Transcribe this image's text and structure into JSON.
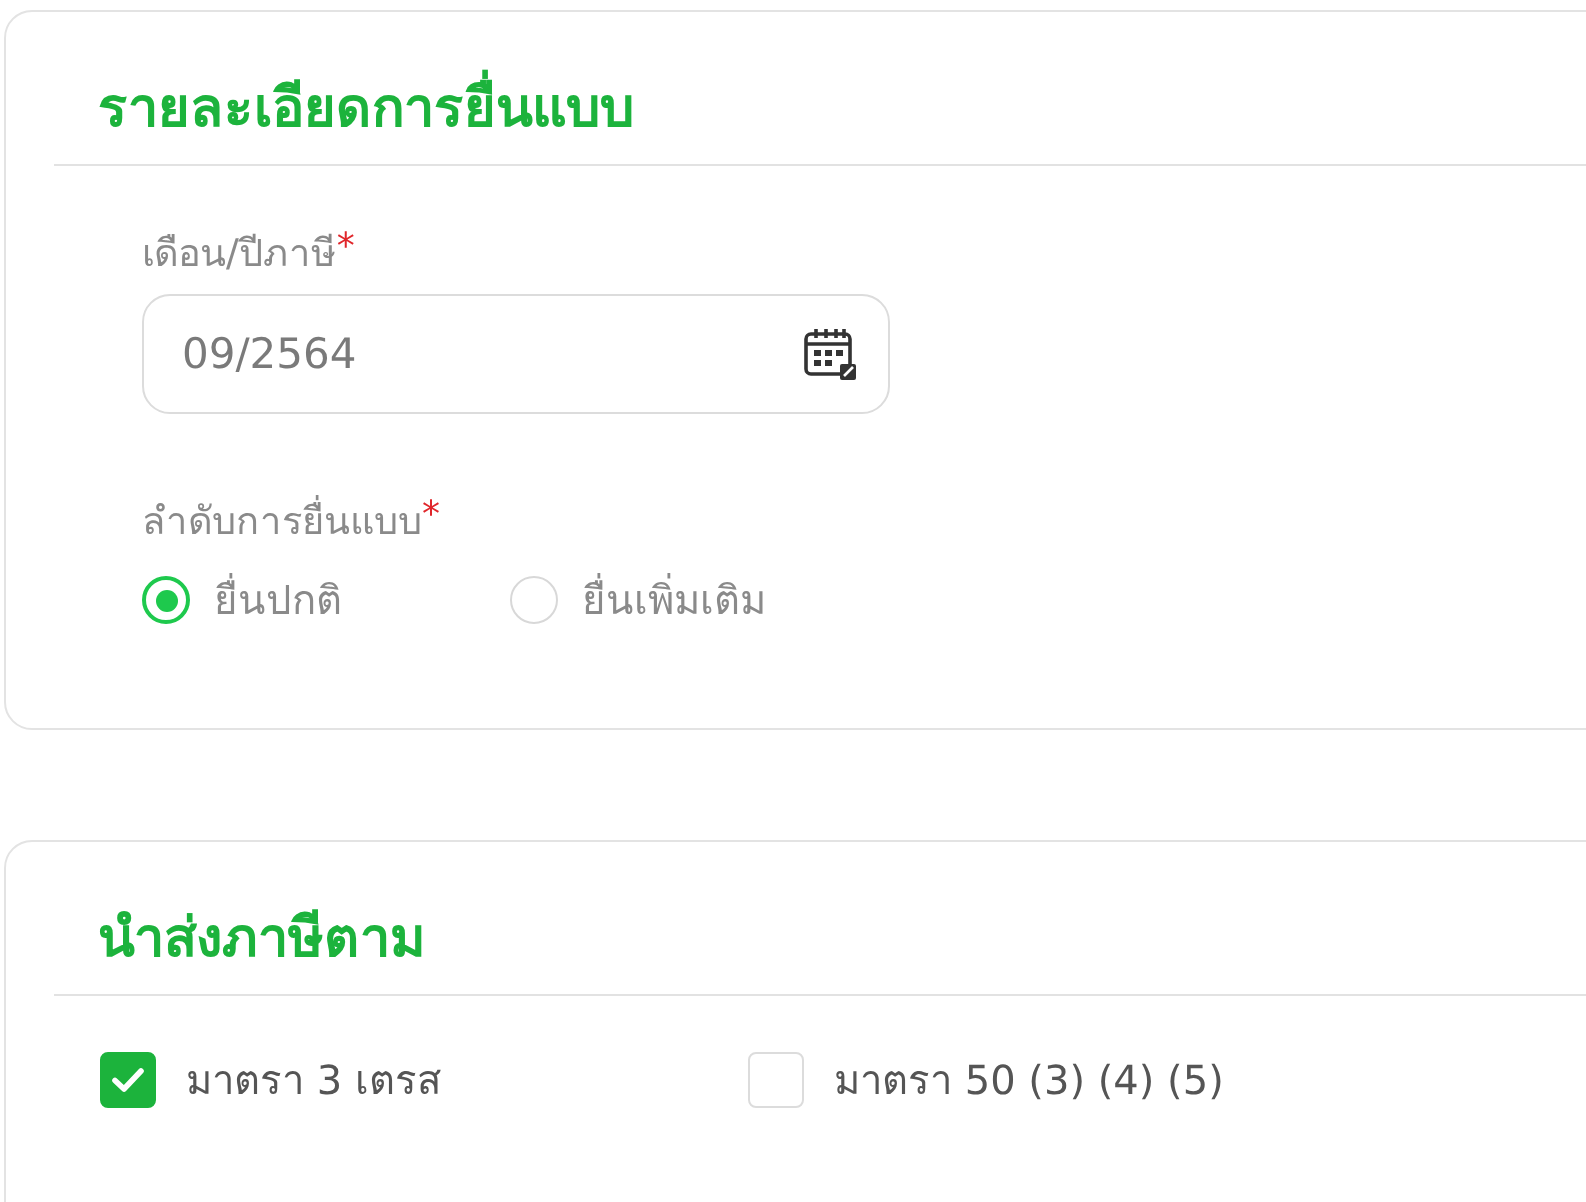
{
  "sections": [
    {
      "title": "รายละเอียดการยื่นแบบ",
      "fields": [
        {
          "kind": "date",
          "label": "เดือน/ปีภาษี",
          "required_mark": "*",
          "value": "09/2564"
        },
        {
          "kind": "radio",
          "label": "ลำดับการยื่นแบบ",
          "required_mark": "*",
          "options": [
            {
              "label": "ยื่นปกติ",
              "selected": true
            },
            {
              "label": "ยื่นเพิ่มเติม",
              "selected": false
            }
          ]
        }
      ]
    },
    {
      "title": "นำส่งภาษีตาม",
      "fields": [
        {
          "kind": "checkboxes",
          "options": [
            {
              "label": "มาตรา 3 เตรส",
              "checked": true
            },
            {
              "label": "มาตรา 50 (3) (4) (5)",
              "checked": false
            }
          ]
        }
      ]
    }
  ]
}
